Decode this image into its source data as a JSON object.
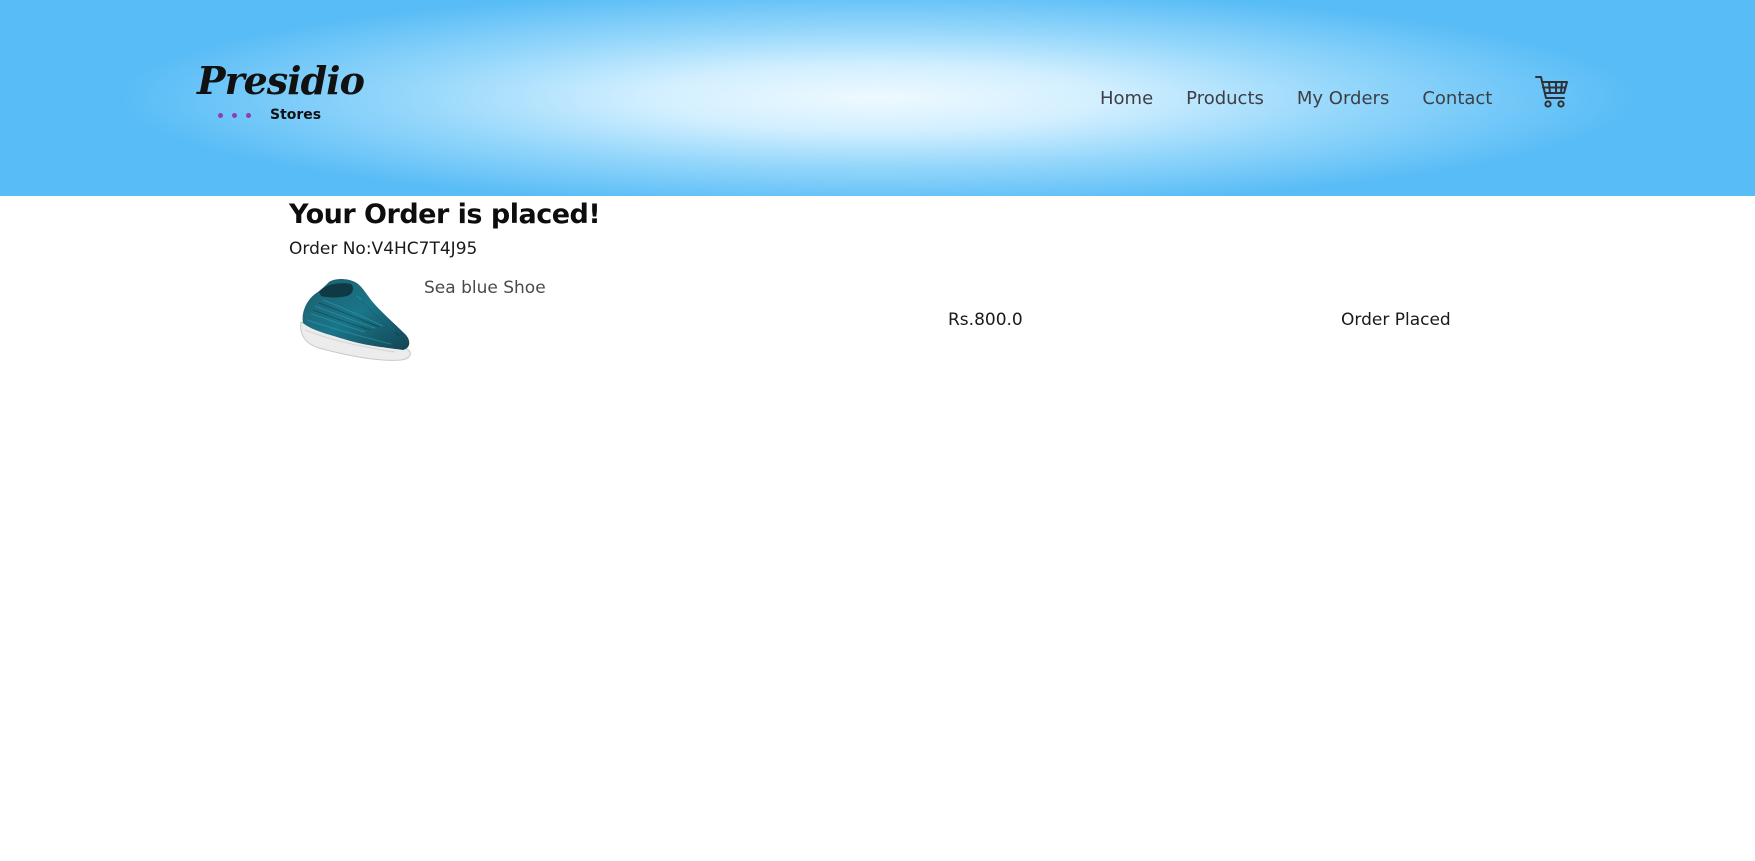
{
  "header": {
    "logo": {
      "script": "Presidio",
      "subtitle": "Stores",
      "dot_color": "#8e3fa8"
    },
    "nav": [
      {
        "label": "Home"
      },
      {
        "label": "Products"
      },
      {
        "label": "My Orders"
      },
      {
        "label": "Contact"
      }
    ],
    "cart_icon": "cart-icon",
    "gradient_colors": [
      "#eef9ff",
      "#58bcf6"
    ]
  },
  "main": {
    "title": "Your Order is placed!",
    "order_no": "Order No:V4HC7T4J95",
    "items": [
      {
        "name": "Sea blue Shoe",
        "price": "Rs.800.0",
        "status": "Order Placed",
        "image_icon": "shoe-image",
        "shoe_color": "#1f6f80"
      }
    ]
  }
}
